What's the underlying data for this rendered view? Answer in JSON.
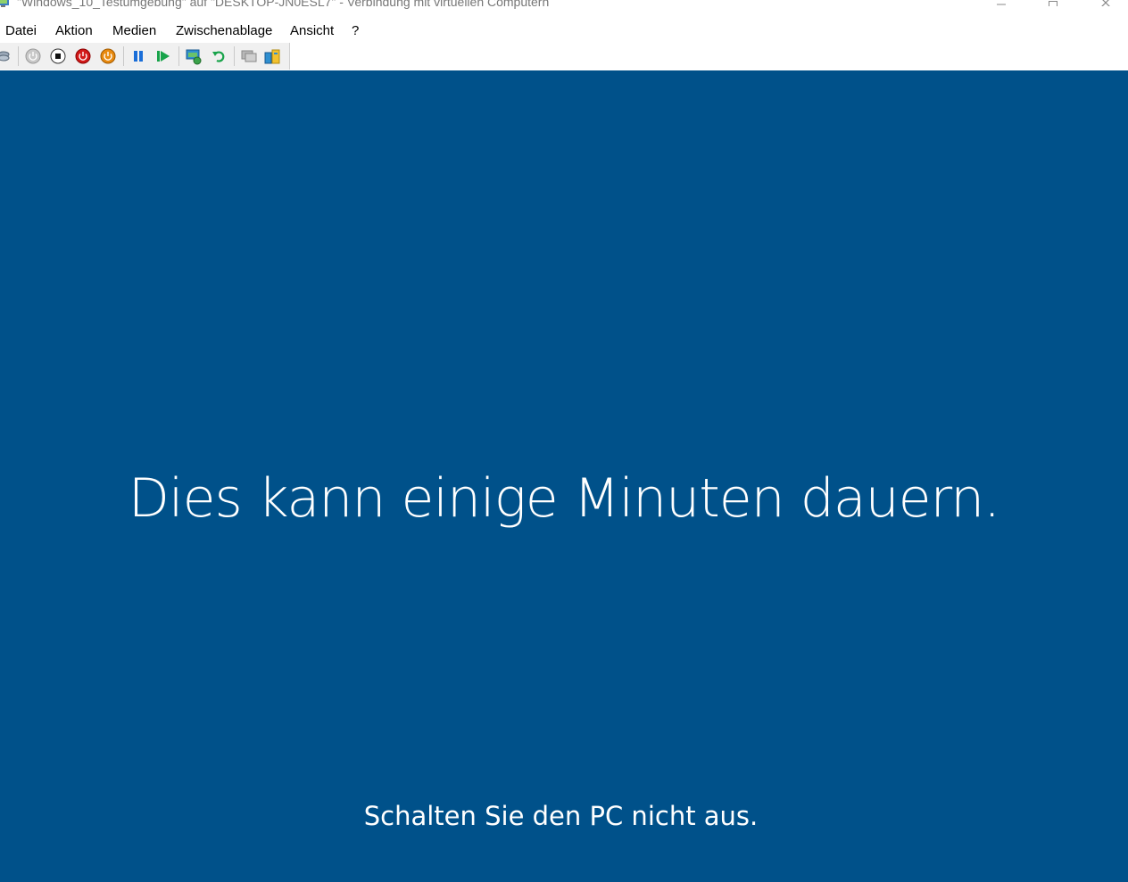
{
  "window": {
    "title": "\"Windows_10_Testumgebung\" auf \"DESKTOP-JN0ESL7\" - Verbindung mit virtuellen Computern",
    "icon": "vm-connect-icon"
  },
  "menu": {
    "items": [
      {
        "label": "Datei"
      },
      {
        "label": "Aktion"
      },
      {
        "label": "Medien"
      },
      {
        "label": "Zwischenablage"
      },
      {
        "label": "Ansicht"
      },
      {
        "label": "?"
      }
    ]
  },
  "toolbar": {
    "buttons": [
      {
        "icon": "ctrl-alt-del-icon"
      },
      {
        "icon": "start-icon"
      },
      {
        "icon": "turn-off-icon"
      },
      {
        "icon": "shut-down-icon"
      },
      {
        "icon": "save-state-icon"
      },
      {
        "icon": "pause-icon"
      },
      {
        "icon": "resume-icon"
      },
      {
        "icon": "checkpoint-icon"
      },
      {
        "icon": "revert-icon"
      },
      {
        "icon": "enhanced-session-icon"
      },
      {
        "icon": "share-icon"
      }
    ]
  },
  "vm_screen": {
    "background_color": "#00518a",
    "message": "Dies kann einige Minuten dauern.",
    "sub_message": "Schalten Sie den PC nicht aus."
  }
}
